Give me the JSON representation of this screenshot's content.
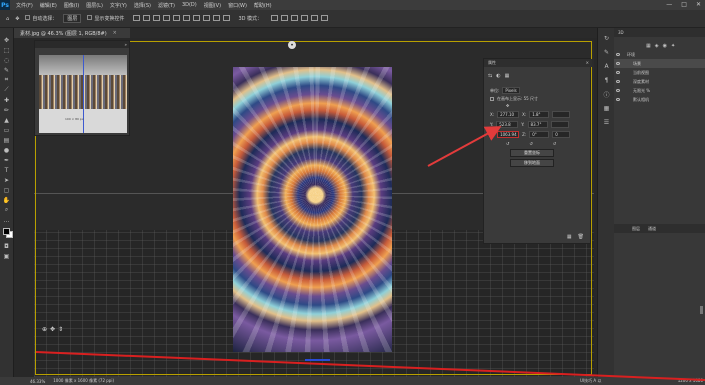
{
  "app": {
    "logo": "Ps"
  },
  "menubar": {
    "items": [
      "文件(F)",
      "编辑(E)",
      "图像(I)",
      "图层(L)",
      "文字(Y)",
      "选择(S)",
      "滤镜(T)",
      "3D(D)",
      "视图(V)",
      "窗口(W)",
      "帮助(H)"
    ],
    "window_buttons": [
      "—",
      "□",
      "✕"
    ]
  },
  "optionsbar": {
    "auto_select_label": "自动选择：",
    "auto_select_value": "图层",
    "show_transform_label": "显示变换控件",
    "mode_label": "3D 模式："
  },
  "document": {
    "tab_title": "素材.jpg @ 46.3% (图层 1, RGB/8#)",
    "tab_close": "×"
  },
  "navigator": {
    "collapse": "»",
    "label": "100 × 80 px"
  },
  "properties": {
    "title": "属性",
    "close": "×",
    "tab_icons": [
      "⇆",
      "◐",
      "▦"
    ],
    "units_label": "单位:",
    "units_value": "Pixels",
    "checkbox_label": "在画布上显示: 55 尺寸",
    "fields": [
      {
        "label": "X:",
        "value": "277.10"
      },
      {
        "label": "Y:",
        "value": "523.8"
      },
      {
        "label": "Z:",
        "value": "1063.94"
      }
    ],
    "angle_fields": [
      {
        "label": "X:",
        "value": "1.8°"
      },
      {
        "label": "Y:",
        "value": "83.7°"
      },
      {
        "label": "Z:",
        "value": "0°"
      }
    ],
    "extra_field": "0",
    "reset_button": "重置坐标",
    "move_button": "移到地面",
    "bottom_icons": [
      "▦",
      "🗑"
    ]
  },
  "layers": {
    "tabs": [
      "3D",
      "图层",
      "通道"
    ],
    "lower_tabs": [
      "图层",
      "通道"
    ],
    "rows": [
      {
        "label": "环境",
        "selected": false
      },
      {
        "label": "场景",
        "selected": true
      },
      {
        "label": "当前视图",
        "selected": false
      },
      {
        "label": "深度素材",
        "selected": false
      },
      {
        "label": "无限光 %",
        "selected": false
      },
      {
        "label": "默认相机",
        "selected": false
      }
    ]
  },
  "statusbar": {
    "zoom": "46.33%",
    "doc_info": "1000 像素 x 1600 像素 (72 ppi)",
    "mid": "UI技巧 A 以",
    "right": "1200 x 1080"
  },
  "toolbar": {
    "icons": [
      "move-icon",
      "marquee-icon",
      "lasso-icon",
      "quick-select-icon",
      "crop-icon",
      "eyedropper-icon",
      "healing-icon",
      "brush-icon",
      "clone-stamp-icon",
      "history-brush-icon",
      "eraser-icon",
      "gradient-icon",
      "blur-icon",
      "dodge-icon",
      "pen-icon",
      "type-icon",
      "path-select-icon",
      "shape-icon",
      "hand-icon",
      "zoom-icon"
    ]
  },
  "widget3d": {
    "icons": [
      "⊕",
      "✥",
      "⇕"
    ]
  },
  "colors": {
    "annotation_arrow": "#e23b3b",
    "canvas_border": "#b8a000",
    "accent": "#31a8ff"
  }
}
